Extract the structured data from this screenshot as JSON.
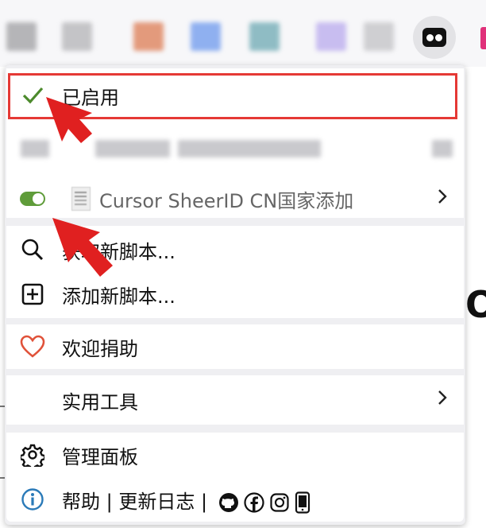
{
  "menu": {
    "enabled_label": "已启用",
    "script_name": "Cursor SheerID CN国家添加",
    "find_new_scripts": "获取新脚本...",
    "add_new_script": "添加新脚本...",
    "donate": "欢迎捐助",
    "utilities": "实用工具",
    "dashboard": "管理面板",
    "help": "帮助",
    "separator1": "|",
    "changelog": "更新日志",
    "separator2": "|"
  },
  "icons": {
    "enabled": "checkmark-icon",
    "script_toggle": "toggle-on-icon",
    "find": "search-icon",
    "add": "plus-square-icon",
    "donate": "heart-icon",
    "dashboard": "gear-icon",
    "help": "info-icon",
    "social": [
      "github-icon",
      "facebook-icon",
      "instagram-icon",
      "mobile-icon"
    ]
  },
  "colors": {
    "check": "#4c8a2c",
    "toggle": "#5f9c3a",
    "heart": "#e0523a",
    "info": "#2a7ab8",
    "highlight_border": "#e53935",
    "annotation_arrow": "#e02020"
  }
}
